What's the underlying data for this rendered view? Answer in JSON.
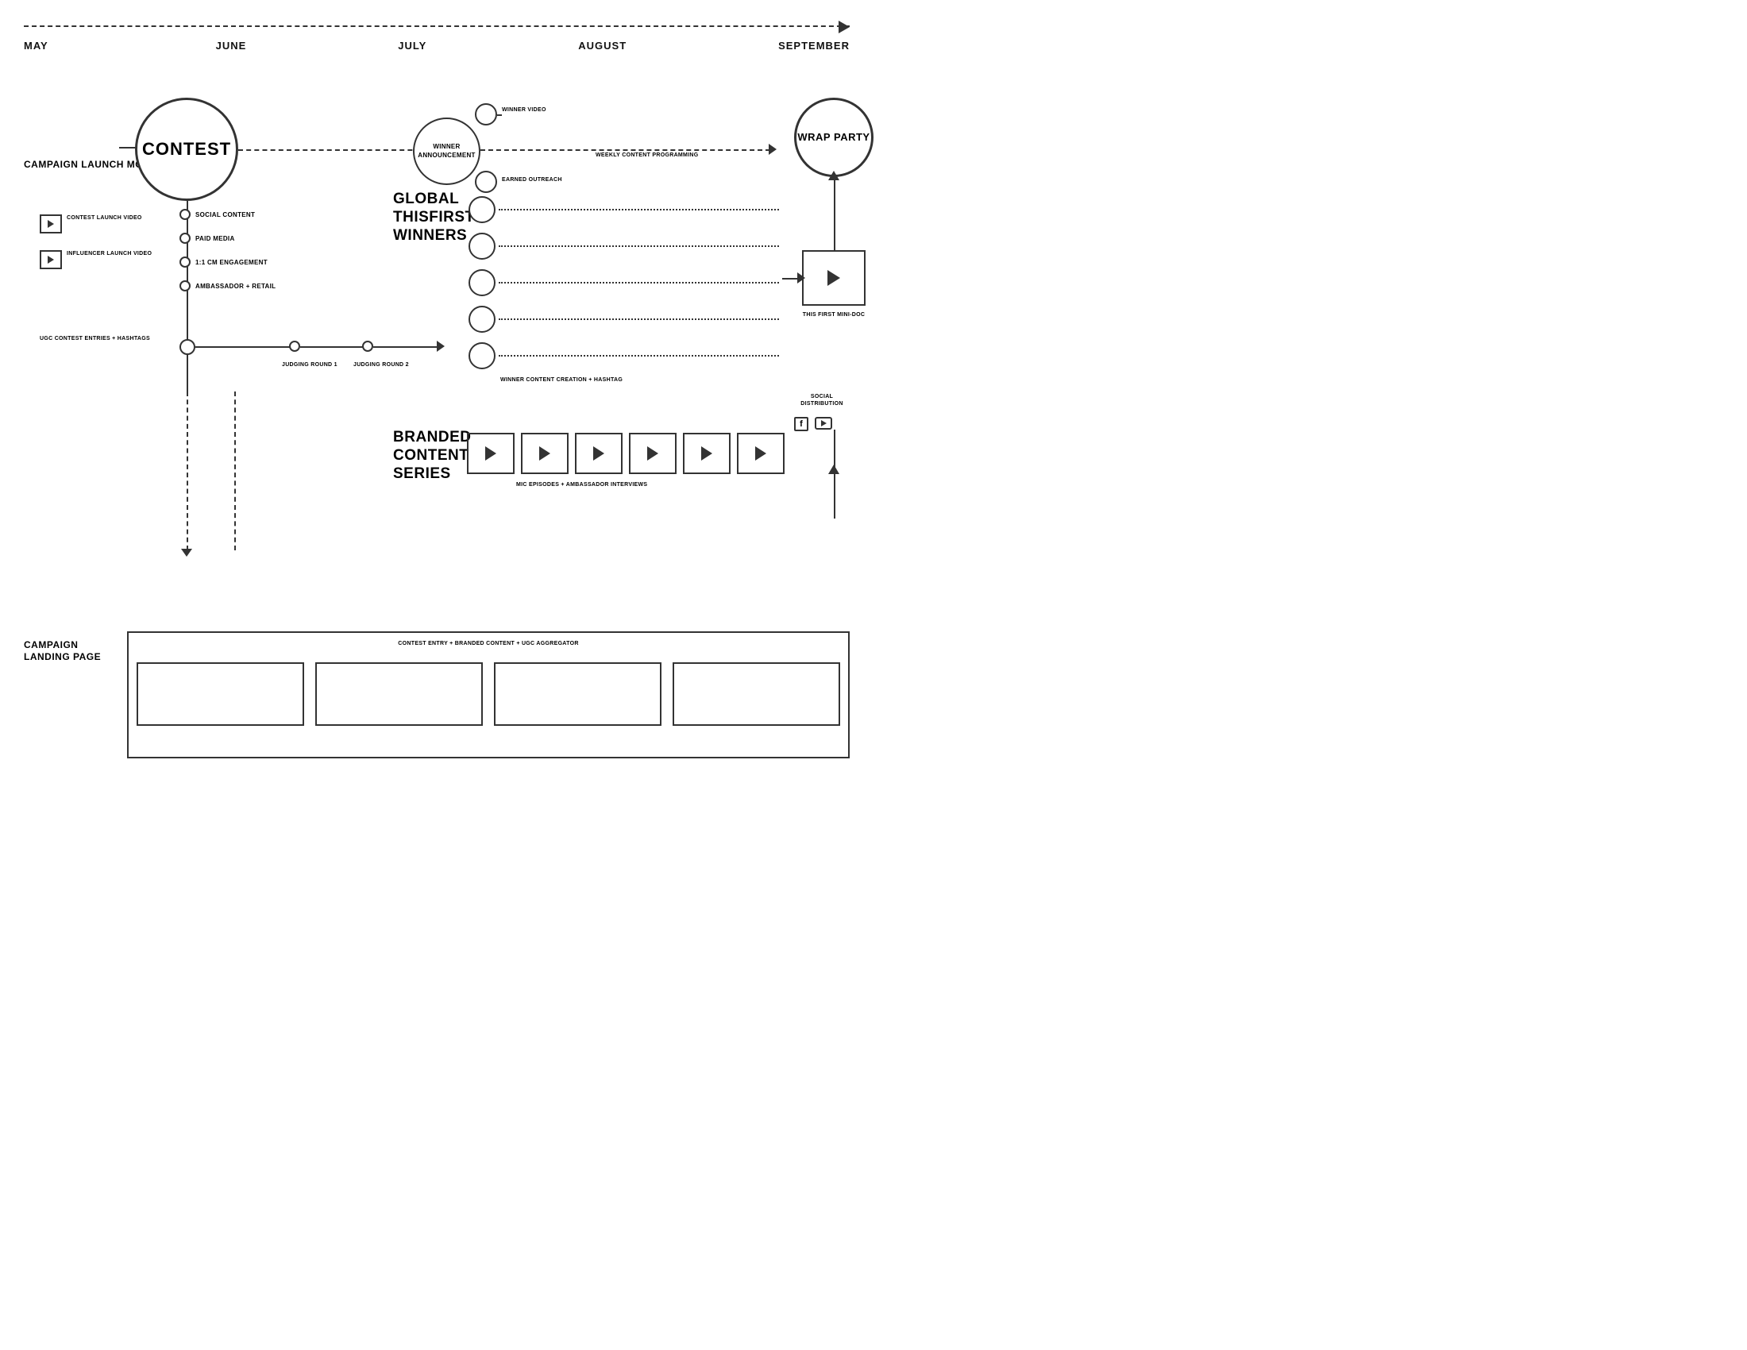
{
  "timeline": {
    "months": [
      "MAY",
      "JUNE",
      "JULY",
      "AUGUST",
      "SEPTEMBER"
    ]
  },
  "sections": {
    "campaign_launch": "CAMPAIGN\nLAUNCH\nMOMENT",
    "contest": "CONTEST",
    "winner_announcement": "WINNER\nANNOUNCEMENT",
    "wrap_party": "WRAP\nPARTY",
    "global_label": "GLOBAL\nTHISFIRST\nWINNERS",
    "branded_label": "BRANDED\nCONTENT\nSERIES",
    "campaign_landing": "CAMPAIGN\nLANDING\nPAGE"
  },
  "labels": {
    "winner_video": "WINNER VIDEO",
    "earned_outreach": "EARNED OUTREACH",
    "weekly_content": "WEEKLY CONTENT PROGRAMMING",
    "social_content": "SOCIAL CONTENT",
    "paid_media": "PAID MEDIA",
    "engagement": "1:1 CM ENGAGEMENT",
    "ambassador": "AMBASSADOR + RETAIL",
    "ugc": "UGC CONTEST\nENTRIES +\nHASHTAGS",
    "judging_r1": "JUDGING\nROUND 1",
    "judging_r2": "JUDGING\nROUND 2",
    "winner_content": "WINNER CONTENT CREATION + HASHTAG",
    "mic_episodes": "MIC EPISODES + AMBASSADOR INTERVIEWS",
    "contest_launch": "CONTEST\nLAUNCH VIDEO",
    "influencer_launch": "INFLUENCER\nLAUNCH VIDEO",
    "this_first_mini": "THIS FIRST MINI-DOC",
    "social_distribution": "SOCIAL\nDISTRIBUTION",
    "landing_text": "CONTEST ENTRY + BRANDED CONTENT + UGC AGGREGATOR"
  }
}
